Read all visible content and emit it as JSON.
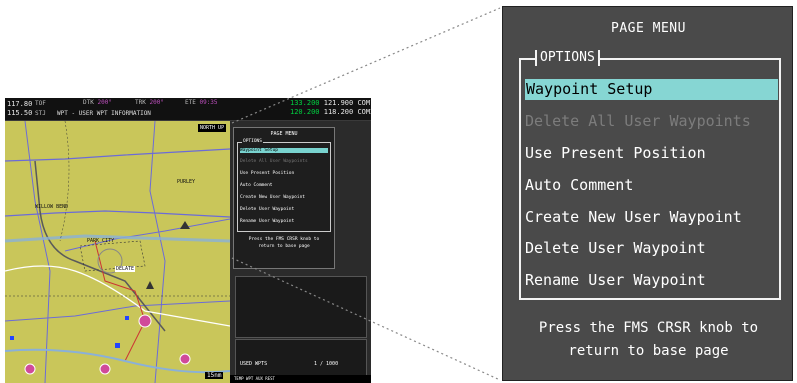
{
  "mfd": {
    "nav1_freq": "117.80",
    "nav2_freq": "115.50",
    "nav_ids": "TOF",
    "nav_ids_2": "STJ",
    "field_1_label": "DTK",
    "field_1_value": "200°",
    "field_2_label": "TRK",
    "field_2_value": "200°",
    "field_3_label": "ETE",
    "field_3_value": "09:35",
    "page_title": "WPT - USER WPT INFORMATION",
    "com1_active": "133.200",
    "com1_standby": "121.900",
    "com2_active": "120.200",
    "com2_standby": "118.200",
    "com1_tag": "COM1",
    "com2_tag": "COM2",
    "north_up": "NORTH UP",
    "range": "15nm",
    "map_labels": [
      "PURLEY",
      "WILLOW BEND",
      "PARK CITY",
      "DELATE"
    ],
    "mini_menu": {
      "title": "PAGE MENU",
      "options_label": "OPTIONS",
      "items": [
        "Waypoint Setup",
        "Delete All User Waypoints",
        "Use Present Position",
        "Auto Comment",
        "Create New User Waypoint",
        "Delete User Waypoint",
        "Rename User Waypoint"
      ],
      "press_line_1": "Press the FMS CRSR knob to",
      "press_line_2": "return to base page"
    },
    "user_wpts_label": "USED WPTS",
    "user_wpts_count": "1 / 1000",
    "softkey_text": "TEMP WPT  AUX REST"
  },
  "page_menu": {
    "title": "PAGE MENU",
    "options_label": "OPTIONS",
    "items": [
      {
        "label": "Waypoint Setup",
        "state": "selected"
      },
      {
        "label": "Delete All User Waypoints",
        "state": "disabled"
      },
      {
        "label": "Use Present Position",
        "state": "enabled"
      },
      {
        "label": "Auto Comment",
        "state": "enabled"
      },
      {
        "label": "Create New User Waypoint",
        "state": "enabled"
      },
      {
        "label": "Delete User Waypoint",
        "state": "enabled"
      },
      {
        "label": "Rename User Waypoint",
        "state": "enabled"
      }
    ],
    "press_line_1": "Press the FMS CRSR knob to",
    "press_line_2": "return to base page"
  },
  "colors": {
    "selection": "#86d6d3",
    "menu_background": "#4a4a4a",
    "map_land": "#c9c65a",
    "disabled_text": "#7c7c7c"
  }
}
